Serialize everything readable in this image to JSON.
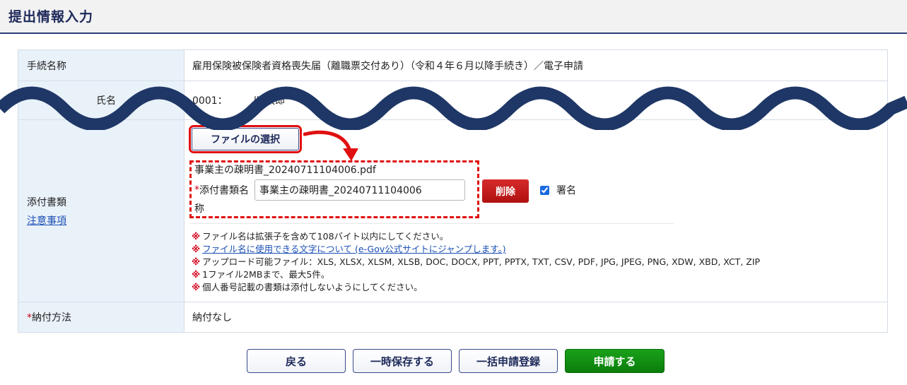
{
  "header": {
    "title": "提出情報入力"
  },
  "form": {
    "procedure": {
      "label": "手続名称",
      "value": "雇用保険被保険者資格喪失届（離職票交付あり）（令和４年６月以降手続き）／電子申請"
    },
    "insured": {
      "label": "氏名",
      "value": "0001：　　　ル 太郎"
    },
    "attachments": {
      "label": "添付書類",
      "notes_link": "注意事項",
      "file_select_label": "ファイルの選択",
      "file_name": "事業主の疎明書_20240711104006.pdf",
      "name_field_required": "*",
      "name_field_label": "添付書類名",
      "name_field_value": "事業主の疎明書_20240711104006",
      "name_field_wrap": "称",
      "delete_label": "削除",
      "sign_label": "署名",
      "sign_checked": true,
      "notes_marker": "※",
      "notes": [
        "ファイル名は拡張子を含めて108バイト以内にしてください。",
        "ファイル名に使用できる文字について (e-Gov公式サイトにジャンプします。)",
        "アップロード可能ファイル：XLS, XLSX, XLSM, XLSB, DOC, DOCX, PPT, PPTX, TXT, CSV, PDF, JPG, JPEG, PNG, XDW, XBD, XCT, ZIP",
        "1ファイル2MBまで、最大5件。",
        "個人番号記載の書類は添付しないようにしてください。"
      ]
    },
    "payment": {
      "required": "*",
      "label": "納付方法",
      "value": "納付なし"
    }
  },
  "buttons": {
    "back": "戻る",
    "save_temp": "一時保存する",
    "batch_register": "一括申請登録",
    "submit": "申請する"
  },
  "colors": {
    "accent_red": "#e01010",
    "wave": "#1e3766",
    "submit_green": "#0a8f0a",
    "label_bg": "#e9f1f9"
  }
}
